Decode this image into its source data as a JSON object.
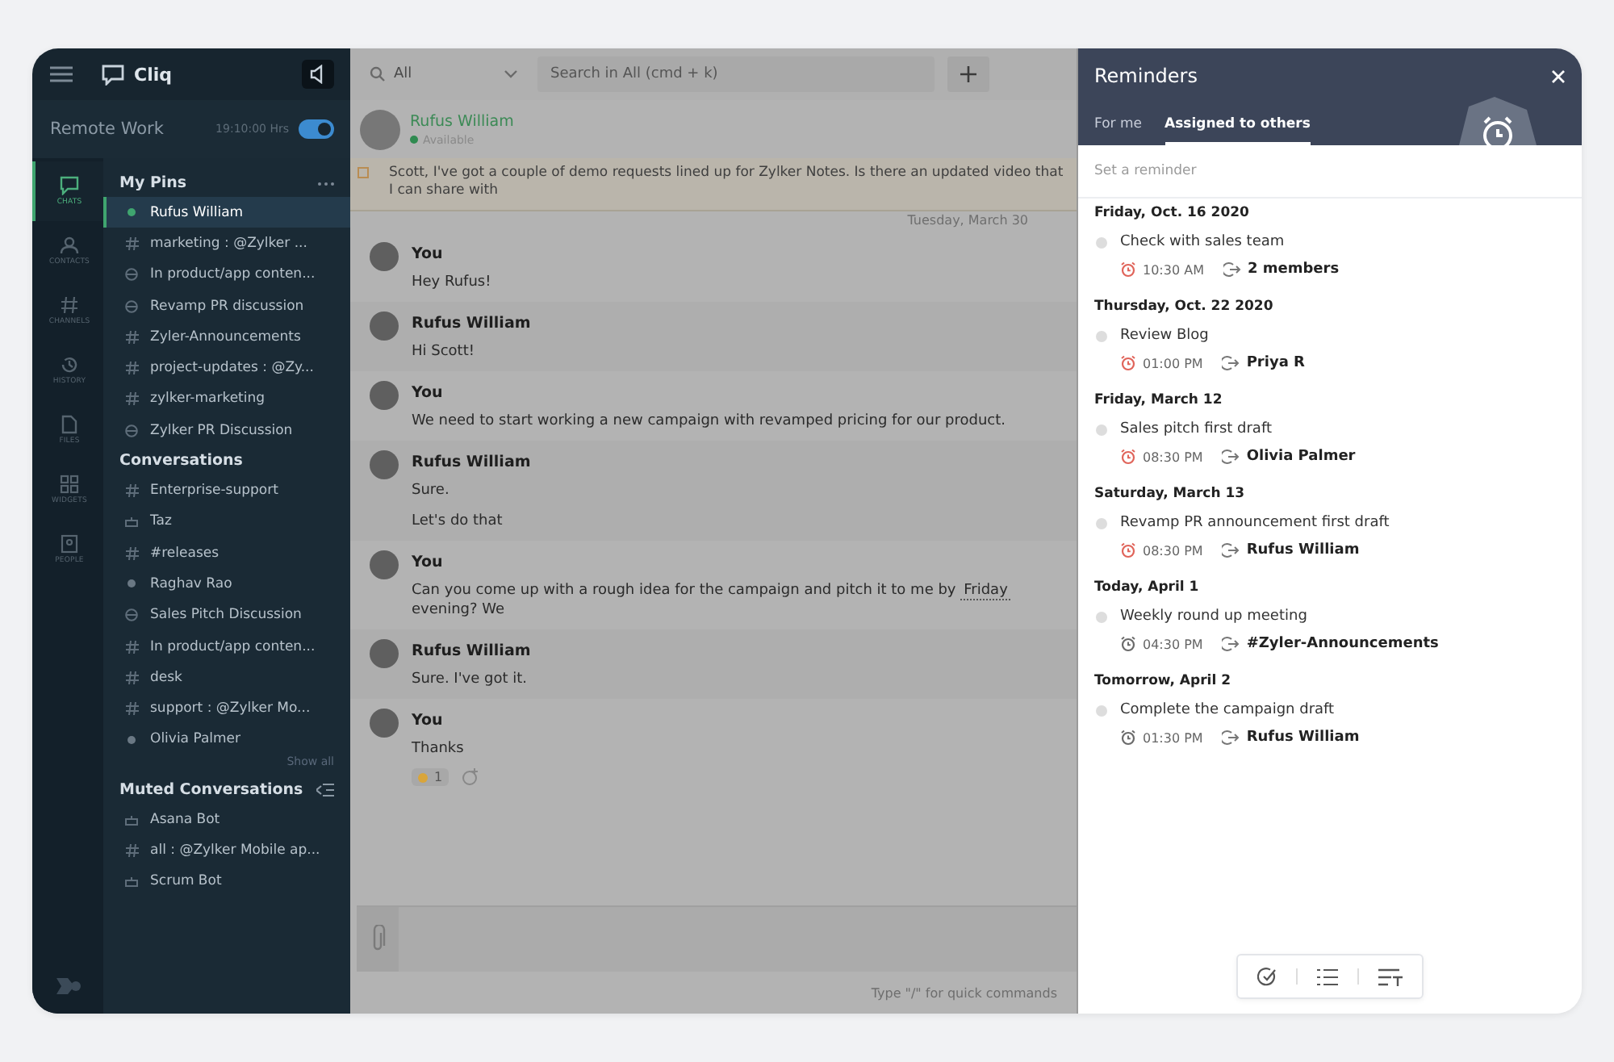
{
  "app": {
    "name": "Cliq",
    "workspace": "Remote Work",
    "clock": "19:10:00 Hrs",
    "clock_on": true
  },
  "rail": [
    {
      "label": "CHATS",
      "kind": "chats",
      "selected": true
    },
    {
      "label": "CONTACTS",
      "kind": "contacts",
      "selected": false
    },
    {
      "label": "CHANNELS",
      "kind": "channels",
      "selected": false
    },
    {
      "label": "HISTORY",
      "kind": "history",
      "selected": false
    },
    {
      "label": "FILES",
      "kind": "files",
      "selected": false
    },
    {
      "label": "WIDGETS",
      "kind": "widgets",
      "selected": false
    },
    {
      "label": "PEOPLE",
      "kind": "people",
      "selected": false
    }
  ],
  "sections": [
    {
      "title": "My Pins",
      "kind": "pins",
      "items": [
        {
          "label": "Rufus William",
          "kind": "user",
          "selected": true
        },
        {
          "label": "marketing : @Zylker ...",
          "kind": "channel",
          "selected": false
        },
        {
          "label": "In product/app conten...",
          "kind": "group",
          "selected": false
        },
        {
          "label": "Revamp PR discussion",
          "kind": "group",
          "selected": false
        },
        {
          "label": "Zyler-Announcements",
          "kind": "channel",
          "selected": false
        },
        {
          "label": "project-updates : @Zy...",
          "kind": "channel",
          "selected": false
        },
        {
          "label": "zylker-marketing",
          "kind": "channel",
          "selected": false
        },
        {
          "label": "Zylker PR Discussion",
          "kind": "group",
          "selected": false
        }
      ]
    },
    {
      "title": "Conversations",
      "kind": "conversations",
      "show_all": "Show all",
      "items": [
        {
          "label": "Enterprise-support",
          "kind": "channel",
          "selected": false
        },
        {
          "label": "Taz",
          "kind": "bot",
          "selected": false
        },
        {
          "label": "#releases",
          "kind": "channel",
          "selected": false
        },
        {
          "label": "Raghav Rao",
          "kind": "user",
          "selected": false
        },
        {
          "label": "Sales Pitch Discussion",
          "kind": "group",
          "selected": false
        },
        {
          "label": "In product/app conten...",
          "kind": "channel",
          "selected": false
        },
        {
          "label": "desk",
          "kind": "channel",
          "selected": false
        },
        {
          "label": "support : @Zylker Mo...",
          "kind": "channel",
          "selected": false
        },
        {
          "label": "Olivia Palmer",
          "kind": "user",
          "selected": false
        }
      ]
    },
    {
      "title": "Muted Conversations",
      "kind": "muted",
      "items": [
        {
          "label": "Asana Bot",
          "kind": "bot",
          "selected": false
        },
        {
          "label": "all : @Zylker Mobile ap...",
          "kind": "channel",
          "selected": false
        },
        {
          "label": "Scrum Bot",
          "kind": "bot",
          "selected": false
        }
      ]
    }
  ],
  "search": {
    "scope": "All",
    "placeholder": "Search in All (cmd + k)"
  },
  "contact": {
    "name": "Rufus William",
    "status": "Available"
  },
  "pinned_message": "Scott, I've got a couple of demo requests lined up for Zylker Notes. Is there an updated video that I can share with",
  "date_divider": "Tuesday, March 30",
  "messages": [
    {
      "sender": "You",
      "lines": [
        [
          {
            "text": "Hey Rufus!",
            "link": false
          }
        ]
      ]
    },
    {
      "sender": "Rufus William",
      "lines": [
        [
          {
            "text": "Hi Scott!",
            "link": false
          }
        ]
      ]
    },
    {
      "sender": "You",
      "lines": [
        [
          {
            "text": "We need to start working a new campaign with revamped pricing for our product.",
            "link": false
          }
        ]
      ]
    },
    {
      "sender": "Rufus William",
      "lines": [
        [
          {
            "text": "Sure.",
            "link": false
          }
        ],
        [
          {
            "text": "Let's do that",
            "link": false
          }
        ]
      ]
    },
    {
      "sender": "You",
      "lines": [
        [
          {
            "text": "Can you come up with a rough idea for the campaign and pitch it to me by ",
            "link": false
          },
          {
            "text": "Friday",
            "link": true
          },
          {
            "text": " evening? We",
            "link": false
          }
        ]
      ]
    },
    {
      "sender": "Rufus William",
      "lines": [
        [
          {
            "text": "Sure. I've got it.",
            "link": false
          }
        ]
      ]
    },
    {
      "sender": "You",
      "lines": [
        [
          {
            "text": "Thanks",
            "link": false
          }
        ]
      ],
      "reaction_count": "1"
    }
  ],
  "composer": {
    "hint": "Type \"/\" for quick commands"
  },
  "reminders": {
    "title": "Reminders",
    "tabs": [
      {
        "label": "For me",
        "selected": false
      },
      {
        "label": "Assigned to others",
        "selected": true
      }
    ],
    "placeholder": "Set a reminder",
    "groups": [
      {
        "date": "Friday, Oct. 16 2020",
        "items": [
          {
            "title": "Check with sales team",
            "time": "10:30 AM",
            "assignee": "2 members",
            "overdue": true,
            "done": false
          }
        ]
      },
      {
        "date": "Thursday, Oct. 22 2020",
        "items": [
          {
            "title": "Review Blog",
            "time": "01:00 PM",
            "assignee": "Priya R",
            "overdue": true,
            "done": false
          }
        ]
      },
      {
        "date": "Friday, March 12",
        "items": [
          {
            "title": "Sales pitch first draft",
            "time": "08:30 PM",
            "assignee": "Olivia Palmer",
            "overdue": true,
            "done": false
          }
        ]
      },
      {
        "date": "Saturday, March 13",
        "items": [
          {
            "title": "Revamp PR announcement first draft",
            "time": "08:30 PM",
            "assignee": "Rufus William",
            "overdue": true,
            "done": false
          }
        ]
      },
      {
        "date": "Today, April 1",
        "items": [
          {
            "title": "Weekly round up meeting",
            "time": "04:30 PM",
            "assignee": "#Zyler-Announcements",
            "overdue": false,
            "done": false
          }
        ]
      },
      {
        "date": "Tomorrow, April 2",
        "items": [
          {
            "title": "Complete the campaign draft",
            "time": "01:30 PM",
            "assignee": "Rufus William",
            "overdue": false,
            "done": false
          }
        ]
      }
    ]
  }
}
